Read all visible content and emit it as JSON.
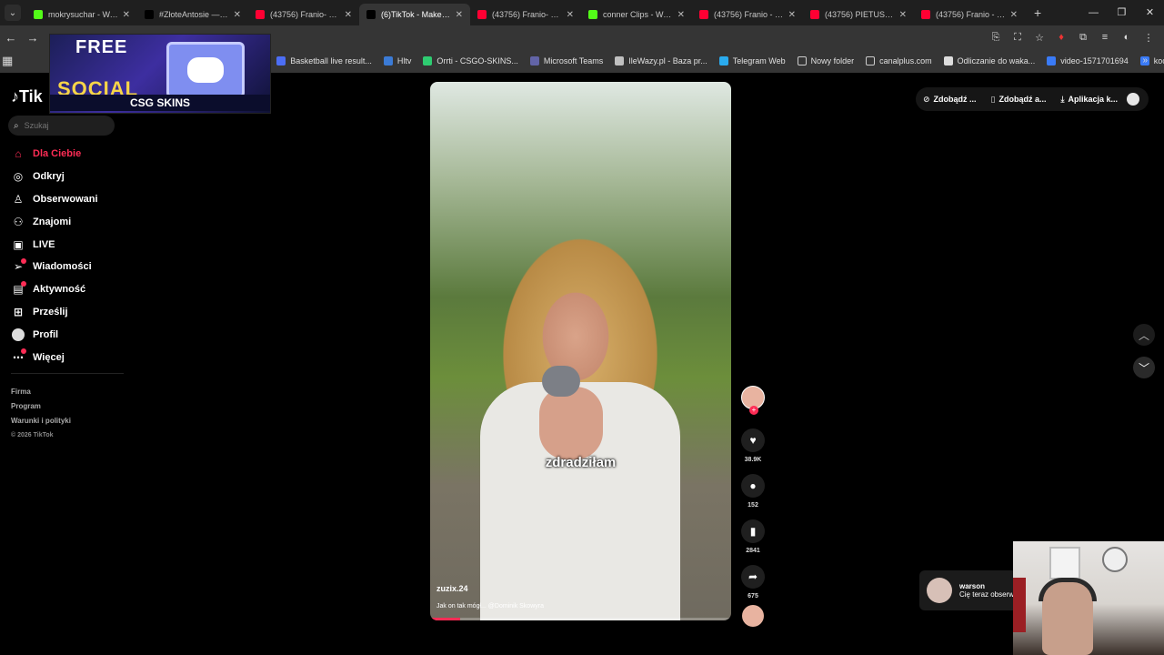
{
  "browser": {
    "tabs": [
      {
        "label": "mokrysuchar - Watch",
        "color": "#53fc18",
        "active": false
      },
      {
        "label": "#ZłoteAntosie — Wy",
        "color": "#000000",
        "active": false
      },
      {
        "label": "(43756) Franio- Klubo",
        "color": "#ff0033",
        "active": false
      },
      {
        "label": "(6)TikTok - Make You",
        "color": "#000000",
        "active": true
      },
      {
        "label": "(43756) Franio- Klubo",
        "color": "#ff0033",
        "active": false
      },
      {
        "label": "conner Clips - Watch",
        "color": "#53fc18",
        "active": false
      },
      {
        "label": "(43756) Franio - Ogu",
        "color": "#ff0033",
        "active": false
      },
      {
        "label": "(43756) PIETUSZEW",
        "color": "#ff0033",
        "active": false
      },
      {
        "label": "(43756) Franio - Skec",
        "color": "#ff0033",
        "active": false
      }
    ],
    "bookmarks": [
      {
        "label": "Basketball live result...",
        "color": "#4c6ef5"
      },
      {
        "label": "Hltv",
        "color": "#3b7bd6"
      },
      {
        "label": "Orrti - CSGO-SKINS...",
        "color": "#2ecc71"
      },
      {
        "label": "Microsoft Teams",
        "color": "#6264a7"
      },
      {
        "label": "IleWazy.pl - Baza pr...",
        "color": "#c0c0c0"
      },
      {
        "label": "Telegram Web",
        "color": "#2aabee"
      },
      {
        "label": "Nowy folder",
        "color": "#353535"
      },
      {
        "label": "canalplus.com",
        "color": "#353535"
      },
      {
        "label": "Odliczanie do waka...",
        "color": "#dddddd"
      },
      {
        "label": "video-1571701694",
        "color": "#3a7bf7"
      },
      {
        "label": "kocica",
        "color": "#3a7bf7"
      }
    ]
  },
  "ad": {
    "line1": "FREE",
    "line2": "SOCIAL",
    "brand": "CSG SKINS"
  },
  "tiktok": {
    "logo": "Tik",
    "search_placeholder": "Szukaj",
    "menu": [
      {
        "label": "Dla Ciebie",
        "icon": "home-icon",
        "glyph": "⌂",
        "active": true
      },
      {
        "label": "Odkryj",
        "icon": "compass-icon",
        "glyph": "◎",
        "active": false
      },
      {
        "label": "Obserwowani",
        "icon": "following-icon",
        "glyph": "♙",
        "active": false
      },
      {
        "label": "Znajomi",
        "icon": "friends-icon",
        "glyph": "⚇",
        "active": false
      },
      {
        "label": "LIVE",
        "icon": "live-icon",
        "glyph": "▣",
        "active": false
      },
      {
        "label": "Wiadomości",
        "icon": "messages-icon",
        "glyph": "➢",
        "active": false
      },
      {
        "label": "Aktywność",
        "icon": "activity-icon",
        "glyph": "▤",
        "active": false
      },
      {
        "label": "Prześlij",
        "icon": "upload-icon",
        "glyph": "⊞",
        "active": false
      },
      {
        "label": "Profil",
        "icon": "profile-icon",
        "glyph": "",
        "active": false
      },
      {
        "label": "Więcej",
        "icon": "more-icon",
        "glyph": "⋯",
        "active": false
      }
    ],
    "footer": {
      "company": "Firma",
      "program": "Program",
      "terms": "Warunki i polityki",
      "copyright": "© 2026 TikTok"
    },
    "top_actions": [
      {
        "label": "Zdobądź ...",
        "icon": "coin-icon",
        "glyph": "⊘"
      },
      {
        "label": "Zdobądź a...",
        "icon": "phone-icon",
        "glyph": "▯"
      },
      {
        "label": "Aplikacja k...",
        "icon": "download-icon",
        "glyph": "⤓"
      }
    ],
    "video": {
      "caption": "zdradziłam",
      "username": "zuzix.24",
      "description": "Jak on tak mógł... @Dominik Skowyra",
      "progress": 0.1
    },
    "stats": {
      "likes": "38.9K",
      "comments": "152",
      "saves": "2841",
      "shares": "675"
    },
    "notification": {
      "user": "warson",
      "text": "Cię teraz obserwuje"
    }
  }
}
